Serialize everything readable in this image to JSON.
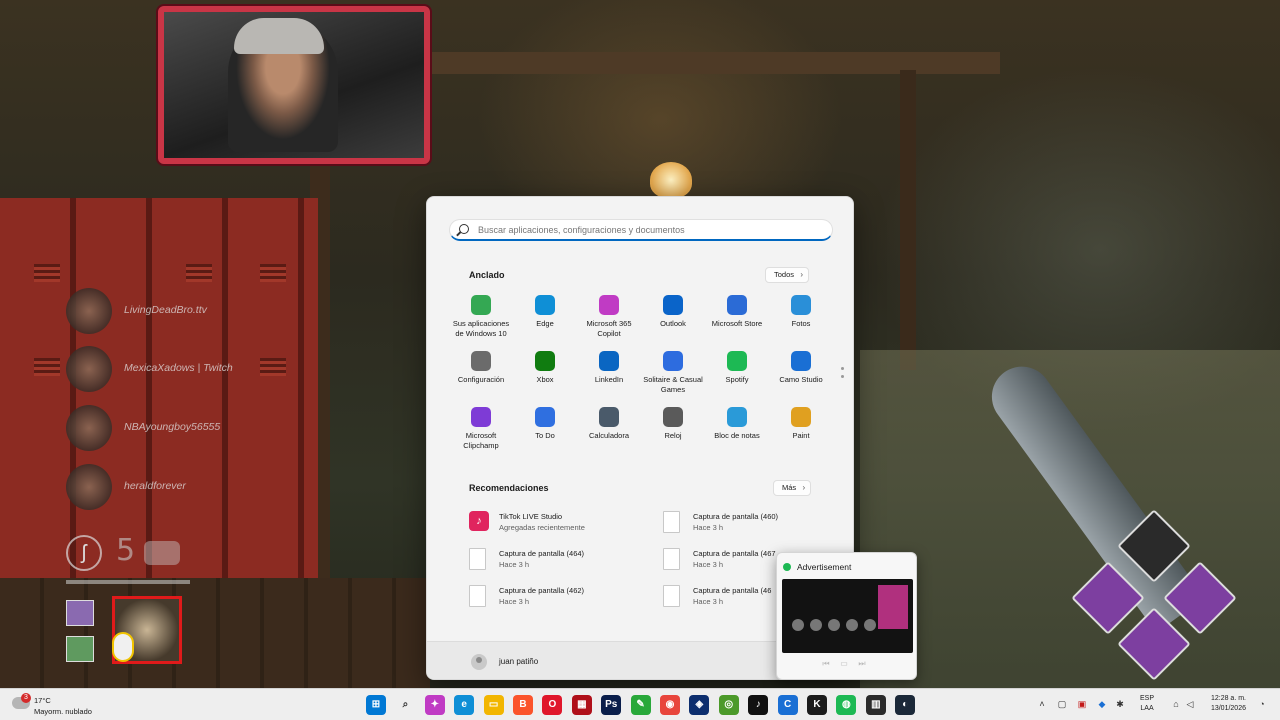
{
  "game": {
    "players": [
      "LivingDeadBro.ttv",
      "MexicaXadows | Twitch",
      "NBAyoungboy56555",
      "heraldforever"
    ],
    "hook_counter": "5"
  },
  "start_menu": {
    "search": {
      "placeholder": "Buscar aplicaciones, configuraciones y documentos"
    },
    "pinned": {
      "title": "Anclado",
      "all_button": "Todos",
      "apps": [
        {
          "label": "Sus aplicaciones de Windows 10",
          "icon": "windows-apps-icon",
          "color": "#34a853"
        },
        {
          "label": "Edge",
          "icon": "edge-icon",
          "color": "#0f8fd6"
        },
        {
          "label": "Microsoft 365 Copilot",
          "icon": "copilot-icon",
          "color": "#c03bc4"
        },
        {
          "label": "Outlook",
          "icon": "outlook-icon",
          "color": "#0a64c9"
        },
        {
          "label": "Microsoft Store",
          "icon": "store-icon",
          "color": "#2b6bd6"
        },
        {
          "label": "Fotos",
          "icon": "photos-icon",
          "color": "#2a8fd8"
        },
        {
          "label": "Configuración",
          "icon": "settings-icon",
          "color": "#6b6b6b"
        },
        {
          "label": "Xbox",
          "icon": "xbox-icon",
          "color": "#107c10"
        },
        {
          "label": "LinkedIn",
          "icon": "linkedin-icon",
          "color": "#0a66c2"
        },
        {
          "label": "Solitaire & Casual Games",
          "icon": "solitaire-icon",
          "color": "#2d6cdf"
        },
        {
          "label": "Spotify",
          "icon": "spotify-icon",
          "color": "#1db954"
        },
        {
          "label": "Camo Studio",
          "icon": "camo-icon",
          "color": "#1a6fd4"
        },
        {
          "label": "Microsoft Clipchamp",
          "icon": "clipchamp-icon",
          "color": "#7e3bd6"
        },
        {
          "label": "To Do",
          "icon": "todo-icon",
          "color": "#2f6fe0"
        },
        {
          "label": "Calculadora",
          "icon": "calculator-icon",
          "color": "#4a5a6a"
        },
        {
          "label": "Reloj",
          "icon": "clock-icon",
          "color": "#5a5a5a"
        },
        {
          "label": "Bloc de notas",
          "icon": "notepad-icon",
          "color": "#2a9ad8"
        },
        {
          "label": "Paint",
          "icon": "paint-icon",
          "color": "#e0a020"
        }
      ]
    },
    "recommended": {
      "title": "Recomendaciones",
      "more_button": "Más",
      "items": [
        {
          "title": "TikTok LIVE Studio",
          "subtitle": "Agregadas recientemente",
          "icon": "tiktok-icon"
        },
        {
          "title": "Captura de pantalla (460)",
          "subtitle": "Hace 3 h",
          "icon": "file-icon"
        },
        {
          "title": "Captura de pantalla (464)",
          "subtitle": "Hace 3 h",
          "icon": "file-icon"
        },
        {
          "title": "Captura de pantalla (467",
          "subtitle": "Hace 3 h",
          "icon": "file-icon"
        },
        {
          "title": "Captura de pantalla (462)",
          "subtitle": "Hace 3 h",
          "icon": "file-icon"
        },
        {
          "title": "Captura de pantalla (46",
          "subtitle": "Hace 3 h",
          "icon": "file-icon"
        }
      ]
    },
    "user": {
      "name": "juan patiño"
    }
  },
  "ad_popup": {
    "title": "Advertisement"
  },
  "taskbar": {
    "weather": {
      "badge": "3",
      "temp": "17°C",
      "description": "Mayorm. nublado"
    },
    "apps": [
      {
        "name": "start-icon",
        "glyph": "⊞",
        "color": "#0078d4"
      },
      {
        "name": "search-taskbar-icon",
        "glyph": "⌕",
        "color": "#333333"
      },
      {
        "name": "copilot-taskbar-icon",
        "glyph": "✦",
        "color": "#c03bc4"
      },
      {
        "name": "edge-taskbar-icon",
        "glyph": "e",
        "color": "#0f8fd6"
      },
      {
        "name": "file-explorer-icon",
        "glyph": "▭",
        "color": "#f2b600"
      },
      {
        "name": "brave-icon",
        "glyph": "B",
        "color": "#fb542b"
      },
      {
        "name": "opera-icon",
        "glyph": "O",
        "color": "#e0172b"
      },
      {
        "name": "recorder-icon",
        "glyph": "▦",
        "color": "#b0101a"
      },
      {
        "name": "photoshop-icon",
        "glyph": "Ps",
        "color": "#0a1e4a"
      },
      {
        "name": "green-app-icon",
        "glyph": "✎",
        "color": "#29a83a"
      },
      {
        "name": "chrome-icon",
        "glyph": "◉",
        "color": "#e8453c"
      },
      {
        "name": "battlenet-icon",
        "glyph": "◈",
        "color": "#0d2e6e"
      },
      {
        "name": "xbox-gamebar-icon",
        "glyph": "◎",
        "color": "#4c9a2a"
      },
      {
        "name": "tiktok-taskbar-icon",
        "glyph": "♪",
        "color": "#111111"
      },
      {
        "name": "camo-taskbar-icon",
        "glyph": "C",
        "color": "#1a6fd4"
      },
      {
        "name": "kick-icon",
        "glyph": "K",
        "color": "#1b1b1b"
      },
      {
        "name": "spotify-taskbar-icon",
        "glyph": "◍",
        "color": "#1db954"
      },
      {
        "name": "dbd-icon",
        "glyph": "▥",
        "color": "#2b2b2b"
      },
      {
        "name": "steam-icon",
        "glyph": "◐",
        "color": "#1b2838"
      }
    ],
    "language": {
      "line1": "ESP",
      "line2": "LAA"
    },
    "clock": {
      "time": "12:28 a. m.",
      "date": "13/01/2026"
    }
  }
}
